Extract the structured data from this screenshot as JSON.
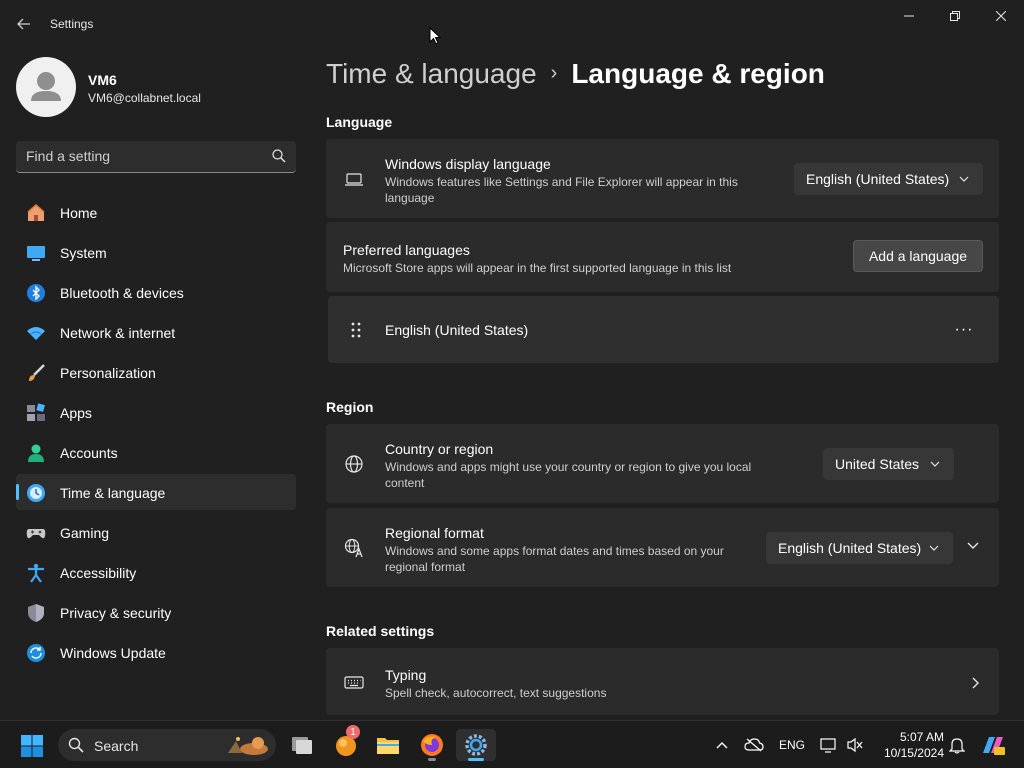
{
  "window": {
    "title": "Settings"
  },
  "profile": {
    "name": "VM6",
    "email": "VM6@collabnet.local"
  },
  "search": {
    "placeholder": "Find a setting"
  },
  "nav": {
    "items": [
      {
        "label": "Home",
        "icon": "home-icon"
      },
      {
        "label": "System",
        "icon": "system-icon"
      },
      {
        "label": "Bluetooth & devices",
        "icon": "bluetooth-icon"
      },
      {
        "label": "Network & internet",
        "icon": "network-icon"
      },
      {
        "label": "Personalization",
        "icon": "brush-icon"
      },
      {
        "label": "Apps",
        "icon": "apps-icon"
      },
      {
        "label": "Accounts",
        "icon": "accounts-icon"
      },
      {
        "label": "Time & language",
        "icon": "time-language-icon"
      },
      {
        "label": "Gaming",
        "icon": "gamepad-icon"
      },
      {
        "label": "Accessibility",
        "icon": "accessibility-icon"
      },
      {
        "label": "Privacy & security",
        "icon": "shield-icon"
      },
      {
        "label": "Windows Update",
        "icon": "update-icon"
      }
    ],
    "active": "Time & language"
  },
  "breadcrumb": {
    "parent": "Time & language",
    "separator": "›",
    "current": "Language & region"
  },
  "sections": {
    "language": {
      "title": "Language",
      "display_language": {
        "title": "Windows display language",
        "description": "Windows features like Settings and File Explorer will appear in this language",
        "value": "English (United States)"
      },
      "preferred": {
        "title": "Preferred languages",
        "description": "Microsoft Store apps will appear in the first supported language in this list",
        "button": "Add a language"
      },
      "languages": [
        {
          "label": "English (United States)",
          "more": "···"
        }
      ]
    },
    "region": {
      "title": "Region",
      "country": {
        "title": "Country or region",
        "description": "Windows and apps might use your country or region to give you local content",
        "value": "United States"
      },
      "format": {
        "title": "Regional format",
        "description": "Windows and some apps format dates and times based on your regional format",
        "value": "English (United States)"
      }
    },
    "related": {
      "title": "Related settings",
      "typing": {
        "title": "Typing",
        "description": "Spell check, autocorrect, text suggestions"
      }
    }
  },
  "taskbar": {
    "search_label": "Search",
    "apps": [
      "task-view-icon",
      "notification-app-icon",
      "file-explorer-icon",
      "firefox-icon",
      "settings-icon"
    ],
    "badge_count": "1",
    "tray": {
      "language": "ENG",
      "time": "5:07 AM",
      "date": "10/15/2024"
    }
  },
  "colors": {
    "accent": "#4cc2ff",
    "background": "#202020",
    "card": "#2b2b2b"
  }
}
